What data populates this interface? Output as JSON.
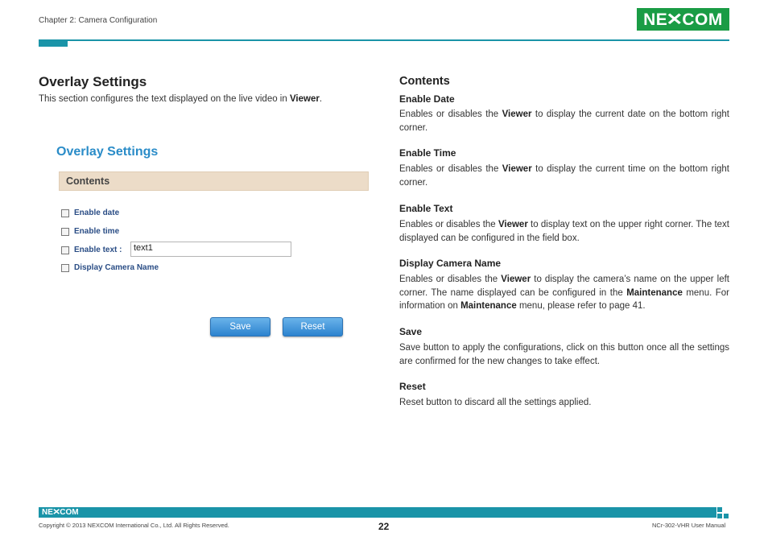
{
  "header": {
    "chapter": "Chapter 2: Camera Configuration",
    "logo": "NE COM",
    "accent_color": "#1a94a8",
    "logo_color": "#1a9c45"
  },
  "left": {
    "title": "Overlay Settings",
    "intro_pre": "This section configures the text displayed on the live video in ",
    "intro_bold": "Viewer",
    "intro_post": "."
  },
  "ui": {
    "title": "Overlay Settings",
    "section": "Contents",
    "checkboxes": [
      {
        "label": "Enable date",
        "checked": false
      },
      {
        "label": "Enable time",
        "checked": false
      },
      {
        "label": "Enable text :",
        "checked": false
      },
      {
        "label": "Display Camera Name",
        "checked": false
      }
    ],
    "text_value": "text1",
    "save_label": "Save",
    "reset_label": "Reset"
  },
  "right": {
    "heading": "Contents",
    "enable_date": {
      "title": "Enable Date",
      "pre": "Enables or disables the ",
      "bold": "Viewer",
      "post": " to display the current date on the bottom right corner."
    },
    "enable_time": {
      "title": "Enable Time",
      "pre": "Enables or disables the ",
      "bold": "Viewer",
      "post": " to display the current time on the bottom right corner."
    },
    "enable_text": {
      "title": "Enable Text",
      "pre": "Enables or disables the ",
      "bold": "Viewer",
      "post": " to display text on the upper right corner. The text displayed can be configured in the field box."
    },
    "display_camera_name": {
      "title": "Display Camera Name",
      "pre": "Enables or disables the ",
      "bold1": "Viewer",
      "mid1": " to display the camera’s name on the upper left corner. The name displayed can be configured in the ",
      "bold2": "Maintenance",
      "mid2": " menu. For information on ",
      "bold3": "Maintenance",
      "post": " menu, please refer to page 41."
    },
    "save": {
      "title": "Save",
      "body": "Save button to apply the configurations, click on this button once all the settings are confirmed for the new changes to take effect."
    },
    "reset": {
      "title": "Reset",
      "body": "Reset button to discard all the settings applied."
    }
  },
  "footer": {
    "logo": "NE COM",
    "copyright": "Copyright © 2013 NEXCOM International Co., Ltd. All Rights Reserved.",
    "page": "22",
    "manual": "NCr-302-VHR User Manual"
  }
}
